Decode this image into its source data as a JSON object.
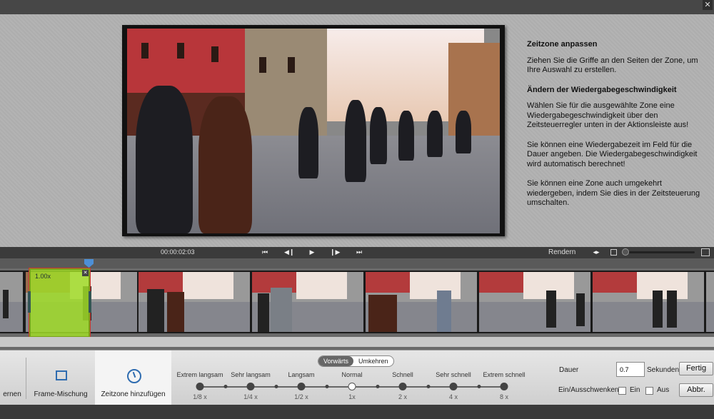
{
  "window": {
    "close_icon": "close-icon"
  },
  "help": {
    "heading1": "Zeitzone anpassen",
    "text1": "Ziehen Sie die Griffe an den Seiten der Zone, um Ihre Auswahl zu erstellen.",
    "heading2": "Ändern der Wiedergabegeschwindigkeit",
    "text2": "Wählen Sie für die ausgewählte Zone eine Wiedergabegeschwindigkeit über den Zeitsteuerregler unten in der Aktionsleiste aus!",
    "text3": "Sie können eine Wiedergabezeit im Feld für die Dauer angeben. Die Wiedergabegeschwindigkeit wird automatisch berechnet!",
    "text4": "Sie können eine Zone auch umgekehrt wiedergeben, indem Sie dies in der Zeitsteuerung umschalten."
  },
  "transport": {
    "timecode": "00:00:02:03",
    "buttons": [
      "go-to-start-icon",
      "step-back-icon",
      "play-icon",
      "step-forward-icon",
      "go-to-end-icon"
    ],
    "render_label": "Rendern"
  },
  "timeline": {
    "zone_label": "1.00x",
    "zone_color": "#a0dc28"
  },
  "actions": {
    "remove_label": "ernen",
    "frame_blend_label": "Frame-Mischung",
    "time_zone_label": "Zeitzone hinzufügen"
  },
  "direction": {
    "forward": "Vorwärts",
    "reverse": "Umkehren",
    "selected": "Vorwärts"
  },
  "speeds": [
    {
      "label": "Extrem langsam",
      "value": "1/8 x"
    },
    {
      "label": "Sehr langsam",
      "value": "1/4 x"
    },
    {
      "label": "Langsam",
      "value": "1/2 x"
    },
    {
      "label": "Normal",
      "value": "1x",
      "selected": true
    },
    {
      "label": "Schnell",
      "value": "2 x"
    },
    {
      "label": "Sehr schnell",
      "value": "4 x"
    },
    {
      "label": "Extrem schnell",
      "value": "8 x"
    }
  ],
  "duration": {
    "label": "Dauer",
    "value": "0.7",
    "unit": "Sekunden",
    "done_button": "Fertig",
    "fade_label": "Ein/Ausschwenken",
    "fade_in": "Ein",
    "fade_out": "Aus",
    "cancel_button": "Abbr."
  }
}
